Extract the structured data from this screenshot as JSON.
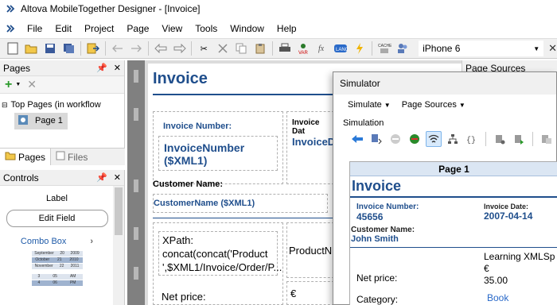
{
  "window": {
    "title": "Altova MobileTogether Designer - [Invoice]"
  },
  "menu": [
    "File",
    "Edit",
    "Project",
    "Page",
    "View",
    "Tools",
    "Window",
    "Help"
  ],
  "toolbar": {
    "device": "iPhone 6"
  },
  "pages_panel": {
    "title": "Pages",
    "tree_root": "Top Pages (in workflow",
    "tree_item": "Page 1",
    "tab_pages": "Pages",
    "tab_files": "Files"
  },
  "controls_panel": {
    "title": "Controls",
    "label_item": "Label",
    "edit_field": "Edit Field",
    "combo_box": "Combo Box",
    "date_rows": [
      [
        "September",
        "20",
        "2009"
      ],
      [
        "October",
        "21",
        "2010"
      ],
      [
        "November",
        "22",
        "2011"
      ]
    ],
    "time_rows": [
      [
        "3",
        "05",
        "AM"
      ],
      [
        "4",
        "06",
        "PM"
      ]
    ]
  },
  "design": {
    "title": "Invoice",
    "invoice_number_label": "Invoice Number:",
    "invoice_number_value": "InvoiceNumber ($XML1)",
    "invoice_date_label": "Invoice Dat",
    "invoice_date_value": "InvoiceD",
    "customer_name_label": "Customer Name:",
    "customer_name_value": "CustomerName ($XML1)",
    "xpath_text": "XPath: concat(concat('Product ',$XML1/Invoice/Order/P...",
    "product_label": "ProductN",
    "euro": "€",
    "net_price": "Net price:"
  },
  "page_sources": {
    "title": "Page Sources"
  },
  "simulator": {
    "title": "Simulator",
    "menu_simulate": "Simulate",
    "menu_page_sources": "Page Sources",
    "group_label": "Simulation",
    "page_header": "Page 1",
    "invoice_title": "Invoice",
    "invoice_number_label": "Invoice Number:",
    "invoice_number_value": "45656",
    "invoice_date_label": "Invoice Date:",
    "invoice_date_value": "2007-04-14",
    "customer_name_label": "Customer Name:",
    "customer_name_value": "John Smith",
    "product_line1": "Learning XMLSp",
    "product_line2": "€",
    "product_line3": "35.00",
    "net_price_label": "Net price:",
    "category_label": "Category:",
    "category_value": "Book"
  }
}
